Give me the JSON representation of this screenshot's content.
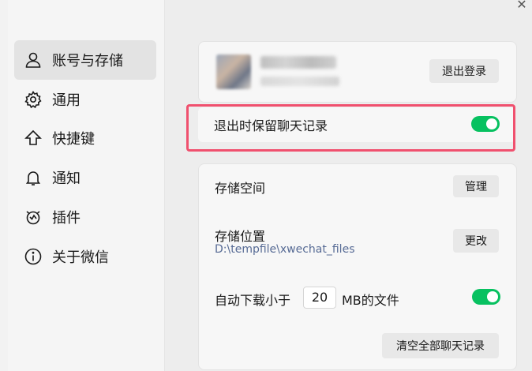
{
  "sidebar": {
    "items": [
      {
        "label": "账号与存储",
        "icon": "user-icon",
        "active": true
      },
      {
        "label": "通用",
        "icon": "gear-icon"
      },
      {
        "label": "快捷键",
        "icon": "shortcut-up-arrow-icon"
      },
      {
        "label": "通知",
        "icon": "bell-icon"
      },
      {
        "label": "插件",
        "icon": "plugin-icon"
      },
      {
        "label": "关于微信",
        "icon": "info-icon"
      }
    ]
  },
  "window": {
    "close_icon": "close-icon",
    "close_glyph": "✕"
  },
  "account": {
    "logout_label": "退出登录"
  },
  "keep_history": {
    "label": "退出时保留聊天记录",
    "enabled": true
  },
  "storage": {
    "space_label": "存储空间",
    "manage_label": "管理",
    "location_label": "存储位置",
    "location_path": "D:\\tempfile\\xwechat_files",
    "change_label": "更改",
    "auto_download_prefix": "自动下载小于",
    "auto_download_value": "20",
    "auto_download_suffix": "MB的文件",
    "auto_download_enabled": true,
    "clear_all_label": "清空全部聊天记录"
  },
  "colors": {
    "accent_green": "#07c160",
    "highlight_red": "#f0506e",
    "path_blue": "#576b95"
  }
}
